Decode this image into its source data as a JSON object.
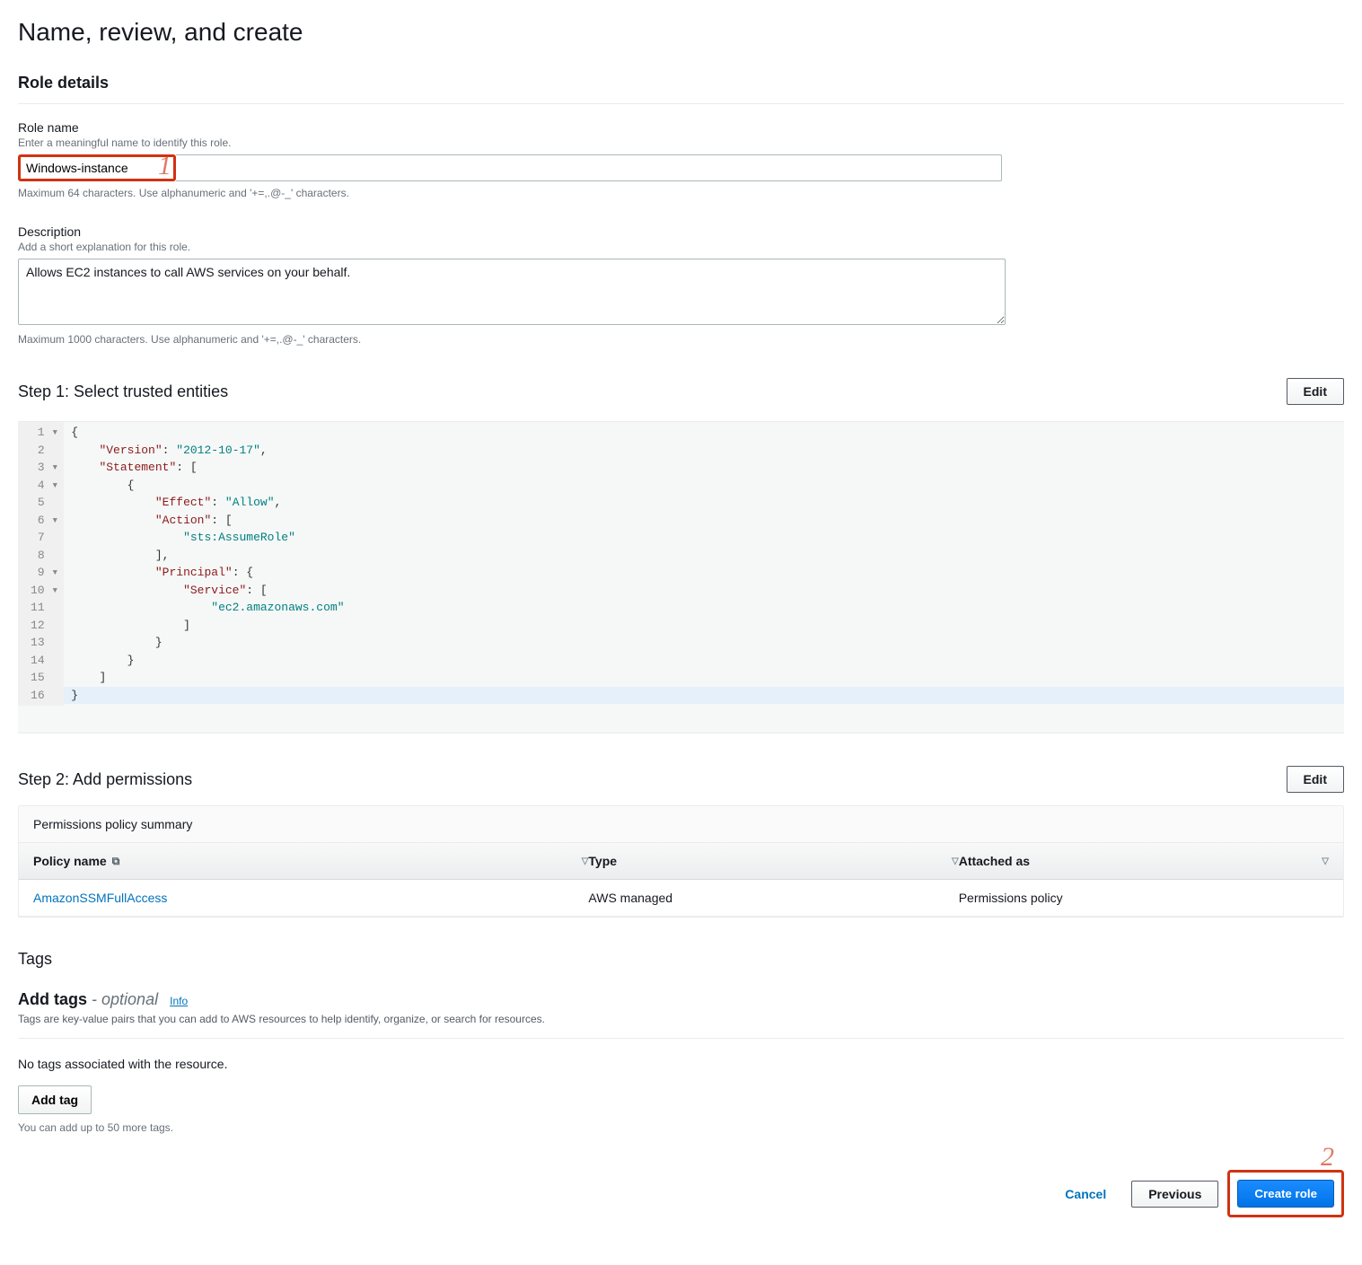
{
  "page": {
    "title": "Name, review, and create"
  },
  "roleDetails": {
    "heading": "Role details",
    "name": {
      "label": "Role name",
      "hint": "Enter a meaningful name to identify this role.",
      "value": "Windows-instance",
      "below": "Maximum 64 characters. Use alphanumeric and '+=,.@-_' characters."
    },
    "description": {
      "label": "Description",
      "hint": "Add a short explanation for this role.",
      "value": "Allows EC2 instances to call AWS services on your behalf.",
      "below": "Maximum 1000 characters. Use alphanumeric and '+=,.@-_' characters."
    }
  },
  "step1": {
    "heading": "Step 1: Select trusted entities",
    "editLabel": "Edit",
    "code": {
      "gutter": " 1 ▾\n 2  \n 3 ▾\n 4 ▾\n 5  \n 6 ▾\n 7  \n 8  \n 9 ▾\n10 ▾\n11  \n12  \n13  \n14  \n15  \n16  ",
      "line1_open": "{",
      "line2_key": "\"Version\"",
      "line2_sep": ": ",
      "line2_val": "\"2012-10-17\"",
      "line2_end": ",",
      "line3_key": "\"Statement\"",
      "line3_sep": ": [",
      "line4": "{",
      "line5_key": "\"Effect\"",
      "line5_sep": ": ",
      "line5_val": "\"Allow\"",
      "line5_end": ",",
      "line6_key": "\"Action\"",
      "line6_sep": ": [",
      "line7_val": "\"sts:AssumeRole\"",
      "line8": "],",
      "line9_key": "\"Principal\"",
      "line9_sep": ": {",
      "line10_key": "\"Service\"",
      "line10_sep": ": [",
      "line11_val": "\"ec2.amazonaws.com\"",
      "line12": "]",
      "line13": "}",
      "line14": "}",
      "line15": "]",
      "line16": "}"
    }
  },
  "step2": {
    "heading": "Step 2: Add permissions",
    "editLabel": "Edit",
    "summary": "Permissions policy summary",
    "columns": {
      "policyName": "Policy name",
      "type": "Type",
      "attachedAs": "Attached as"
    },
    "rows": [
      {
        "name": "AmazonSSMFullAccess",
        "type": "AWS managed",
        "attachedAs": "Permissions policy"
      }
    ]
  },
  "tags": {
    "heading": "Tags",
    "addTags": "Add tags",
    "optional": "- optional",
    "info": "Info",
    "desc": "Tags are key-value pairs that you can add to AWS resources to help identify, organize, or search for resources.",
    "noTags": "No tags associated with the resource.",
    "addTagBtn": "Add tag",
    "below": "You can add up to 50 more tags."
  },
  "footer": {
    "cancel": "Cancel",
    "previous": "Previous",
    "create": "Create role"
  },
  "callouts": {
    "one": "1",
    "two": "2"
  }
}
